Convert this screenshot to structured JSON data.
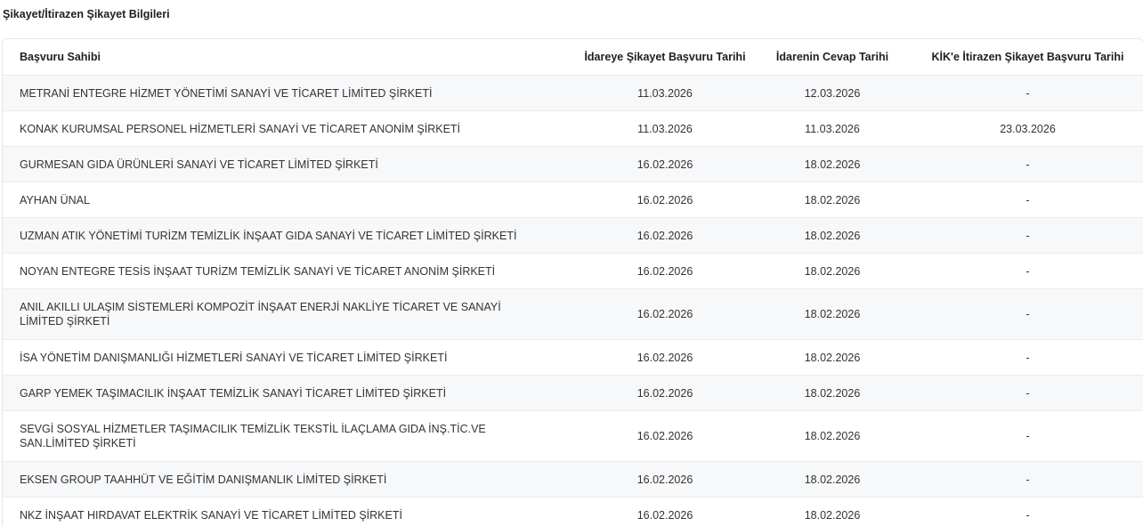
{
  "section": {
    "title": "Şikayet/İtirazen Şikayet Bilgileri"
  },
  "table": {
    "headers": {
      "applicant": "Başvuru Sahibi",
      "complaint_date": "İdareye Şikayet Başvuru Tarihi",
      "response_date": "İdarenin Cevap Tarihi",
      "kik_date": "KİK'e İtirazen Şikayet Başvuru Tarihi"
    },
    "rows": [
      {
        "applicant": "METRANİ ENTEGRE HİZMET YÖNETİMİ SANAYİ VE TİCARET LİMİTED ŞİRKETİ",
        "complaint_date": "11.03.2026",
        "response_date": "12.03.2026",
        "kik_date": "-"
      },
      {
        "applicant": "KONAK KURUMSAL PERSONEL HİZMETLERİ SANAYİ VE TİCARET ANONİM ŞİRKETİ",
        "complaint_date": "11.03.2026",
        "response_date": "11.03.2026",
        "kik_date": "23.03.2026"
      },
      {
        "applicant": "GURMESAN GIDA ÜRÜNLERİ SANAYİ VE TİCARET LİMİTED ŞİRKETİ",
        "complaint_date": "16.02.2026",
        "response_date": "18.02.2026",
        "kik_date": "-"
      },
      {
        "applicant": "AYHAN ÜNAL",
        "complaint_date": "16.02.2026",
        "response_date": "18.02.2026",
        "kik_date": "-"
      },
      {
        "applicant": "UZMAN ATIK YÖNETİMİ TURİZM TEMİZLİK İNŞAAT GIDA SANAYİ VE TİCARET LİMİTED ŞİRKETİ",
        "complaint_date": "16.02.2026",
        "response_date": "18.02.2026",
        "kik_date": "-"
      },
      {
        "applicant": "NOYAN ENTEGRE TESİS İNŞAAT TURİZM TEMİZLİK SANAYİ VE TİCARET ANONİM ŞİRKETİ",
        "complaint_date": "16.02.2026",
        "response_date": "18.02.2026",
        "kik_date": "-"
      },
      {
        "applicant": "ANIL AKILLI ULAŞIM SİSTEMLERİ KOMPOZİT İNŞAAT ENERJİ NAKLİYE TİCARET VE SANAYİ LİMİTED ŞİRKETİ",
        "complaint_date": "16.02.2026",
        "response_date": "18.02.2026",
        "kik_date": "-"
      },
      {
        "applicant": "İSA YÖNETİM DANIŞMANLIĞI HİZMETLERİ SANAYİ VE TİCARET LİMİTED ŞİRKETİ",
        "complaint_date": "16.02.2026",
        "response_date": "18.02.2026",
        "kik_date": "-"
      },
      {
        "applicant": "GARP YEMEK TAŞIMACILIK İNŞAAT TEMİZLİK SANAYİ TİCARET LİMİTED ŞİRKETİ",
        "complaint_date": "16.02.2026",
        "response_date": "18.02.2026",
        "kik_date": "-"
      },
      {
        "applicant": "SEVGİ SOSYAL HİZMETLER TAŞIMACILIK TEMİZLİK TEKSTİL İLAÇLAMA GIDA İNŞ.TİC.VE SAN.LİMİTED ŞİRKETİ",
        "complaint_date": "16.02.2026",
        "response_date": "18.02.2026",
        "kik_date": "-"
      },
      {
        "applicant": "EKSEN GROUP TAAHHÜT VE EĞİTİM DANIŞMANLIK LİMİTED ŞİRKETİ",
        "complaint_date": "16.02.2026",
        "response_date": "18.02.2026",
        "kik_date": "-"
      },
      {
        "applicant": "NKZ İNŞAAT HIRDAVAT ELEKTRİK SANAYİ VE TİCARET LİMİTED ŞİRKETİ",
        "complaint_date": "16.02.2026",
        "response_date": "18.02.2026",
        "kik_date": "-"
      }
    ]
  }
}
